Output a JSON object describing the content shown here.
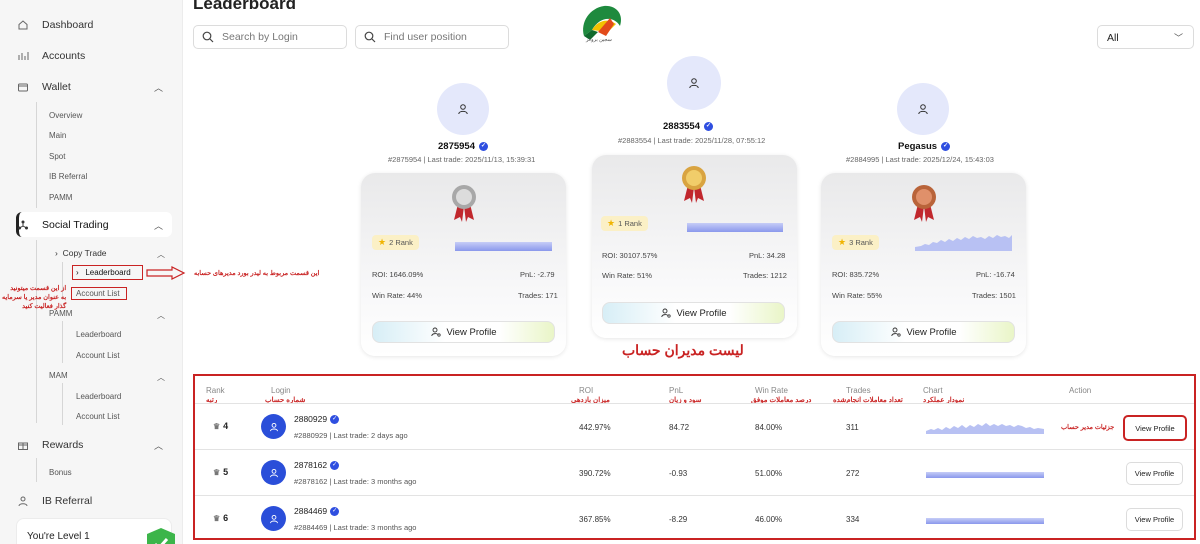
{
  "sidebar": {
    "dashboard": "Dashboard",
    "accounts": "Accounts",
    "wallet": "Wallet",
    "wallet_items": [
      "Overview",
      "Main",
      "Spot",
      "IB Referral",
      "PAMM"
    ],
    "social_trading": "Social Trading",
    "copy_trade": "Copy Trade",
    "copy_trade_items": [
      "Leaderboard",
      "Account List"
    ],
    "pamm": "PAMM",
    "pamm_items": [
      "Leaderboard",
      "Account List"
    ],
    "mam": "MAM",
    "mam_items": [
      "Leaderboard",
      "Account List"
    ],
    "rewards": "Rewards",
    "rewards_items": [
      "Bonus"
    ],
    "ib_referral": "IB Referral",
    "level_text": "You're Level 1"
  },
  "header": {
    "title": "Leaderboard",
    "search_login_placeholder": "Search by Login",
    "find_user_placeholder": "Find user position",
    "filter_value": "All",
    "logo_caption": "سجین بروکر"
  },
  "podium": [
    {
      "name": "2875954",
      "sub": "#2875954 | Last trade: 2025/11/13, 15:39:31",
      "rank_label": "2 Rank",
      "roi": "ROI: 1646.09%",
      "pnl": "PnL: -2.79",
      "win_rate": "Win Rate: 44%",
      "trades": "Trades: 171",
      "button": "View Profile",
      "medal": "silver-medal-icon"
    },
    {
      "name": "2883554",
      "sub": "#2883554 | Last trade: 2025/11/28, 07:55:12",
      "rank_label": "1 Rank",
      "roi": "ROI: 30107.57%",
      "pnl": "PnL: 34.28",
      "win_rate": "Win Rate: 51%",
      "trades": "Trades: 1212",
      "button": "View Profile",
      "medal": "gold-medal-icon"
    },
    {
      "name": "Pegasus",
      "sub": "#2884995 | Last trade: 2025/12/24, 15:43:03",
      "rank_label": "3 Rank",
      "roi": "ROI: 835.72%",
      "pnl": "PnL: -16.74",
      "win_rate": "Win Rate: 55%",
      "trades": "Trades: 1501",
      "button": "View Profile",
      "medal": "bronze-medal-icon"
    }
  ],
  "table": {
    "headers": {
      "rank": "Rank",
      "login": "Login",
      "roi": "ROI",
      "pnl": "PnL",
      "win_rate": "Win Rate",
      "trades": "Trades",
      "chart": "Chart",
      "action": "Action"
    },
    "headers_fa": {
      "rank": "رتبه",
      "login": "شماره حساب",
      "roi": "میزان بازدهی",
      "pnl": "سود و زیان",
      "win_rate": "درصد معاملات موفق",
      "trades": "تعداد معاملات انجام‌شده",
      "chart": "نمودار عملکرد"
    },
    "rows": [
      {
        "rank": "4",
        "login": "2880929",
        "sub": "#2880929 | Last trade: 2 days ago",
        "roi": "442.97%",
        "pnl": "84.72",
        "win_rate": "84.00%",
        "trades": "311",
        "action": "View Profile"
      },
      {
        "rank": "5",
        "login": "2878162",
        "sub": "#2878162 | Last trade: 3 months ago",
        "roi": "390.72%",
        "pnl": "-0.93",
        "win_rate": "51.00%",
        "trades": "272",
        "action": "View Profile"
      },
      {
        "rank": "6",
        "login": "2884469",
        "sub": "#2884469 | Last trade: 3 months ago",
        "roi": "367.85%",
        "pnl": "-8.29",
        "win_rate": "46.00%",
        "trades": "334",
        "action": "View Profile"
      }
    ]
  },
  "annotations": {
    "leaderboard_note": "این قسمت مربوط به لیدر بورد مدیرهای حسابه",
    "account_list_note": [
      "از این قسمت میتونید",
      "به عنوان مدیر یا سرمایه",
      "گذار فعالیت کنید"
    ],
    "managers_list": "لیست مدیران حساب",
    "details_note": "جزئیات مدیر حساب"
  },
  "colors": {
    "accent": "#2a4ed9",
    "annotation_red": "#c92323",
    "rank_pill": "#fbf0c6"
  }
}
